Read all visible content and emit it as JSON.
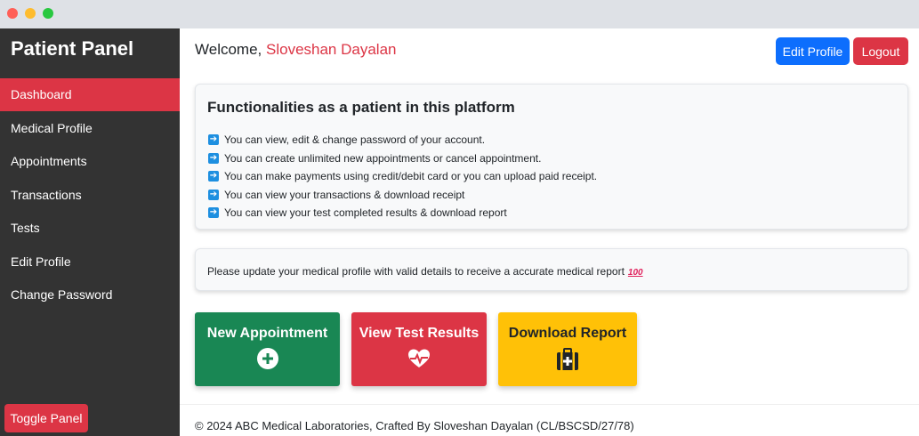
{
  "sidebar": {
    "title": "Patient Panel",
    "items": [
      {
        "label": "Dashboard",
        "active": true
      },
      {
        "label": "Medical Profile"
      },
      {
        "label": "Appointments"
      },
      {
        "label": "Transactions"
      },
      {
        "label": "Tests"
      },
      {
        "label": "Edit Profile"
      },
      {
        "label": "Change Password"
      }
    ],
    "toggle_label": "Toggle Panel"
  },
  "header": {
    "welcome_prefix": "Welcome,",
    "user_name": "Sloveshan Dayalan",
    "edit_profile_label": "Edit Profile",
    "logout_label": "Logout"
  },
  "functionalities": {
    "title": "Functionalities as a patient in this platform",
    "bullet_icon": "right-arrow-icon",
    "items": [
      "You can view, edit & change password of your account.",
      "You can create unlimited new appointments or cancel appointment.",
      "You can make payments using credit/debit card or you can upload paid receipt.",
      "You can view your transactions & download receipt",
      "You can view your test completed results & download report"
    ]
  },
  "notice": {
    "text": "Please update your medical profile with valid details to receive a accurate medical report",
    "emoji": "💯",
    "emoji_icon": "hundred-points-icon"
  },
  "actions": [
    {
      "label": "New Appointment",
      "icon": "plus-circle-icon",
      "color": "#198754"
    },
    {
      "label": "View Test Results",
      "icon": "heart-pulse-icon",
      "color": "#dc3545"
    },
    {
      "label": "Download Report",
      "icon": "medical-kit-icon",
      "color": "#ffc107"
    }
  ],
  "footer": {
    "text": "© 2024 ABC Medical Laboratories, Crafted By Sloveshan Dayalan (CL/BSCSD/27/78)"
  },
  "colors": {
    "sidebar_bg": "#333333",
    "accent_red": "#dc3545",
    "primary_blue": "#0d6efd",
    "success_green": "#198754",
    "warning_yellow": "#ffc107"
  }
}
